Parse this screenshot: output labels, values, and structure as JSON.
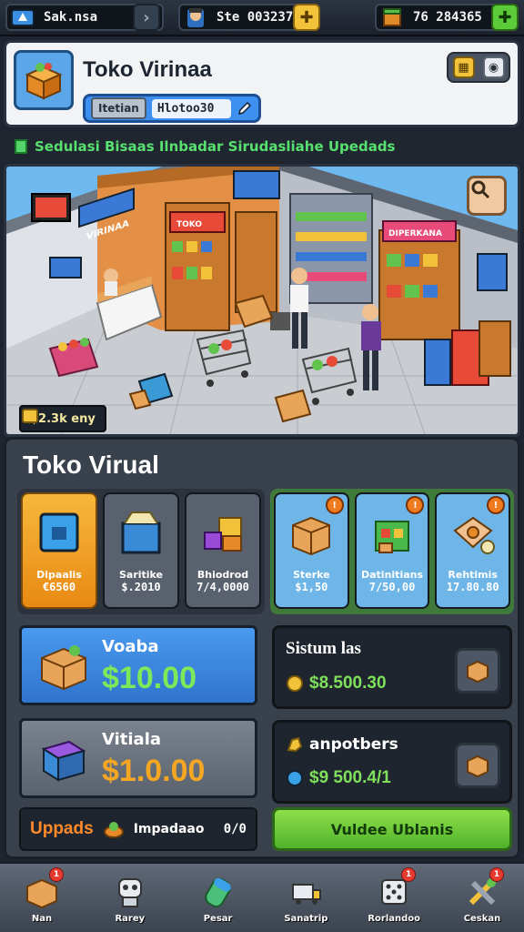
{
  "topbar": {
    "player": "Sak.nsa",
    "coins": "Ste 003237",
    "gems": "76 284365"
  },
  "header": {
    "title": "Toko Virinaa",
    "tag_label": "Itetian",
    "tag_value": "Hlotoo30"
  },
  "banner": {
    "text": "Sedulasi Bisaas Ilnbadar Sirudasliahe Upedads"
  },
  "scene": {
    "earn_text": "$2.3k eny",
    "sign_1": "TOKO",
    "sign_2": "VIRINAA",
    "sign_3": "DIPERKANA"
  },
  "panel": {
    "title": "Toko Virual",
    "shop_items": [
      {
        "name": "Dipaalis",
        "price": "€6560",
        "icon": "blue-cube-icon",
        "badge": ""
      },
      {
        "name": "Saritike",
        "price": "$.2010",
        "icon": "crate-icon",
        "badge": ""
      },
      {
        "name": "Bhiodrod",
        "price": "7/4,0000",
        "icon": "boxes-icon",
        "badge": ""
      },
      {
        "name": "Sterke",
        "price": "$1,50",
        "icon": "cardboard-box-icon",
        "badge": "!"
      },
      {
        "name": "Datinitians",
        "price": "7/50,00",
        "icon": "green-crate-icon",
        "badge": "!"
      },
      {
        "name": "Rehtimis",
        "price": "17.80.80",
        "icon": "coin-box-icon",
        "badge": "!"
      }
    ],
    "money_cards": [
      {
        "label": "Voaba",
        "amount": "$10.00",
        "color": "#7ce85a"
      },
      {
        "label": "Vitiala",
        "amount": "$1.0.00",
        "color": "#f5a623"
      }
    ],
    "stats": [
      {
        "title": "Sistum las",
        "value": "$8.500.30"
      },
      {
        "title": "anpotbers",
        "value": "$9 500.4/1"
      }
    ],
    "upgrades": {
      "label": "Uppads",
      "sub": "Impadaao",
      "count": "0/0"
    },
    "green_button": "Vuldee Ublanis"
  },
  "bottom_nav": [
    {
      "label": "Nan",
      "icon": "box-icon",
      "badge": "1"
    },
    {
      "label": "Rarey",
      "icon": "robot-icon",
      "badge": ""
    },
    {
      "label": "Pesar",
      "icon": "battery-icon",
      "badge": ""
    },
    {
      "label": "Sanatrip",
      "icon": "truck-icon",
      "badge": "",
      "side": "O/s"
    },
    {
      "label": "Rorlandoo",
      "icon": "dice-icon",
      "badge": "1",
      "side": "D"
    },
    {
      "label": "Ceskan",
      "icon": "tools-icon",
      "badge": "1"
    }
  ],
  "colors": {
    "accent_blue": "#3d8ff0",
    "accent_green": "#58e070",
    "accent_orange": "#f5a623"
  }
}
